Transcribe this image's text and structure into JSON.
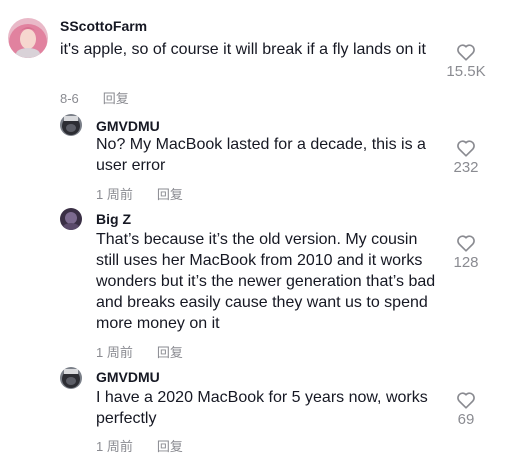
{
  "comments": [
    {
      "username": "SScottoFarm",
      "text": "it's apple, so of course it will break if a fly lands on it",
      "date": "8-6",
      "reply_label": "回复",
      "likes": "15.5K",
      "avatar_icon": "pink-hair-avatar"
    },
    {
      "username": "GMVDMU",
      "text": "No? My MacBook lasted for a decade, this is a user error",
      "date": "1 周前",
      "reply_label": "回复",
      "likes": "232",
      "avatar_icon": "gorilla-avatar"
    },
    {
      "username": "Big Z",
      "text": "That’s because it’s the old version. My cousin still uses her MacBook from 2010 and it works wonders but it’s the newer generation that’s bad and breaks easily cause they want us to spend more money on it",
      "date": "1 周前",
      "reply_label": "回复",
      "likes": "128",
      "avatar_icon": "dark-purple-avatar"
    },
    {
      "username": "GMVDMU",
      "text": "I have a 2020 MacBook for 5 years now, works perfectly",
      "date": "1 周前",
      "reply_label": "回复",
      "likes": "69",
      "avatar_icon": "gorilla-avatar"
    }
  ],
  "colors": {
    "text": "#161823",
    "muted": "#8a8b91",
    "background": "#ffffff"
  }
}
